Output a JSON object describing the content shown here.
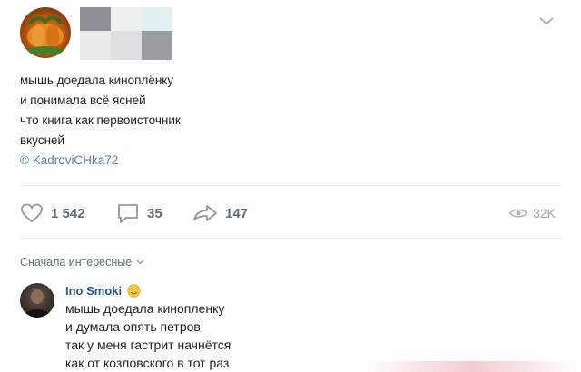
{
  "post": {
    "menu_icon": "chevron-down-icon",
    "text_lines": [
      "мышь доедала киноплёнку",
      "и понимала всё ясней",
      "что книга как первоисточник",
      "вкусней"
    ],
    "source": "© KadroviCHka72"
  },
  "actions": {
    "likes": "1 542",
    "comments": "35",
    "shares": "147",
    "views": "32K",
    "icons": [
      "heart-icon",
      "comment-icon",
      "share-icon",
      "eye-icon"
    ]
  },
  "comments_section": {
    "sort_label": "Сначала интересные",
    "comment": {
      "author": "Ino Smoki",
      "text_lines": [
        "мышь доедала кинопленку",
        "и думала опять петров",
        "так у меня гастрит начнётся",
        "как от козловского в тот раз"
      ]
    }
  },
  "colors": {
    "link": "#2a5885",
    "muted": "#626d7a",
    "divider": "#e7e8ec"
  }
}
